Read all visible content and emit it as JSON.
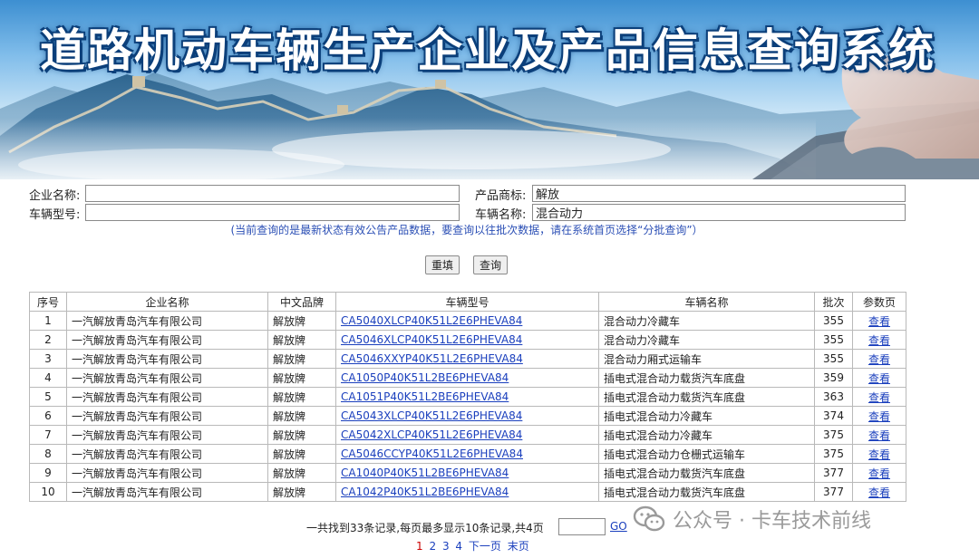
{
  "banner": {
    "title": "道路机动车辆生产企业及产品信息查询系统"
  },
  "form": {
    "company_label": "企业名称:",
    "company_value": "",
    "brand_label": "产品商标:",
    "brand_value": "解放",
    "model_label": "车辆型号:",
    "model_value": "",
    "vehicle_name_label": "车辆名称:",
    "vehicle_name_value": "混合动力",
    "notice": "(当前查询的是最新状态有效公告产品数据，要查询以往批次数据，请在系统首页选择“分批查询”）",
    "reset_label": "重填",
    "search_label": "查询"
  },
  "table": {
    "headers": [
      "序号",
      "企业名称",
      "中文品牌",
      "车辆型号",
      "车辆名称",
      "批次",
      "参数页"
    ],
    "rows": [
      {
        "no": "1",
        "company": "一汽解放青岛汽车有限公司",
        "brand": "解放牌",
        "model": "CA5040XLCP40K51L2E6PHEVA84",
        "name": "混合动力冷藏车",
        "batch": "355",
        "view": "查看"
      },
      {
        "no": "2",
        "company": "一汽解放青岛汽车有限公司",
        "brand": "解放牌",
        "model": "CA5046XLCP40K51L2E6PHEVA84",
        "name": "混合动力冷藏车",
        "batch": "355",
        "view": "查看"
      },
      {
        "no": "3",
        "company": "一汽解放青岛汽车有限公司",
        "brand": "解放牌",
        "model": "CA5046XXYP40K51L2E6PHEVA84",
        "name": "混合动力厢式运输车",
        "batch": "355",
        "view": "查看"
      },
      {
        "no": "4",
        "company": "一汽解放青岛汽车有限公司",
        "brand": "解放牌",
        "model": "CA1050P40K51L2BE6PHEVA84",
        "name": "插电式混合动力载货汽车底盘",
        "batch": "359",
        "view": "查看"
      },
      {
        "no": "5",
        "company": "一汽解放青岛汽车有限公司",
        "brand": "解放牌",
        "model": "CA1051P40K51L2BE6PHEVA84",
        "name": "插电式混合动力载货汽车底盘",
        "batch": "363",
        "view": "查看"
      },
      {
        "no": "6",
        "company": "一汽解放青岛汽车有限公司",
        "brand": "解放牌",
        "model": "CA5043XLCP40K51L2E6PHEVA84",
        "name": "插电式混合动力冷藏车",
        "batch": "374",
        "view": "查看"
      },
      {
        "no": "7",
        "company": "一汽解放青岛汽车有限公司",
        "brand": "解放牌",
        "model": "CA5042XLCP40K51L2E6PHEVA84",
        "name": "插电式混合动力冷藏车",
        "batch": "375",
        "view": "查看"
      },
      {
        "no": "8",
        "company": "一汽解放青岛汽车有限公司",
        "brand": "解放牌",
        "model": "CA5046CCYP40K51L2E6PHEVA84",
        "name": "插电式混合动力仓栅式运输车",
        "batch": "375",
        "view": "查看"
      },
      {
        "no": "9",
        "company": "一汽解放青岛汽车有限公司",
        "brand": "解放牌",
        "model": "CA1040P40K51L2BE6PHEVA84",
        "name": "插电式混合动力载货汽车底盘",
        "batch": "377",
        "view": "查看"
      },
      {
        "no": "10",
        "company": "一汽解放青岛汽车有限公司",
        "brand": "解放牌",
        "model": "CA1042P40K51L2BE6PHEVA84",
        "name": "插电式混合动力载货汽车底盘",
        "batch": "377",
        "view": "查看"
      }
    ]
  },
  "pagination": {
    "summary": "一共找到33条记录,每页最多显示10条记录,共4页",
    "page_input_value": "",
    "go_label": "GO",
    "pages": [
      "1",
      "2",
      "3",
      "4"
    ],
    "current_page": "1",
    "next_label": "下一页",
    "last_label": "末页"
  },
  "watermark": {
    "text": "公众号 · 卡车技术前线",
    "icon": "wechat-icon"
  },
  "colors": {
    "link": "#1a3fbd",
    "notice": "#2b4fb5",
    "current_page": "#cc0000",
    "title_outline": "#0b3f7a"
  }
}
